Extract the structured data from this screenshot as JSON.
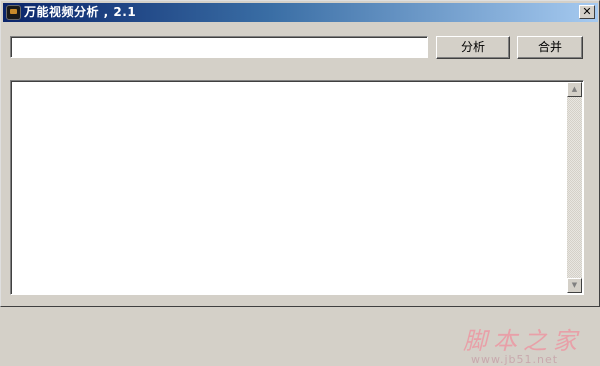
{
  "window": {
    "title": "万能视频分析 , 2.1",
    "close_label": "✕"
  },
  "toolbar": {
    "url_value": "",
    "url_placeholder": "",
    "analyze_label": "分析",
    "merge_label": "合并"
  },
  "output": {
    "text": ""
  },
  "scrollbar": {
    "up_arrow": "▲",
    "down_arrow": "▼"
  },
  "watermark": {
    "brand": "脚本之家",
    "url": "www.jb51.net"
  },
  "colors": {
    "titlebar_start": "#0a246a",
    "titlebar_end": "#a6caf0",
    "window_bg": "#d4d0c8",
    "watermark": "#e8a0a8"
  }
}
